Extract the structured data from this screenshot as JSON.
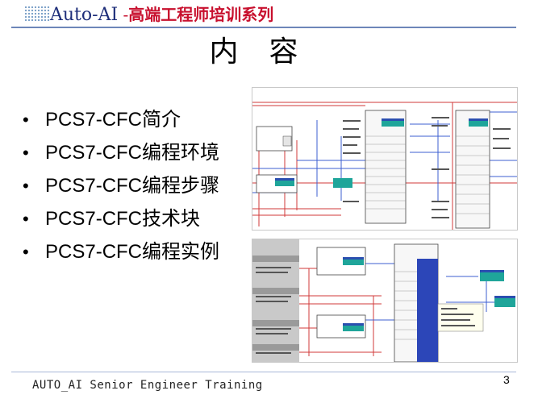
{
  "header": {
    "brand_auto": "Auto-",
    "brand_ai": "AI",
    "brand_dash": " -",
    "brand_subtitle": "高端工程师培训系列"
  },
  "title": "内容",
  "bullets": [
    "PCS7-CFC简介",
    "PCS7-CFC编程环境",
    "PCS7-CFC编程步骤",
    "PCS7-CFC技术块",
    "PCS7-CFC编程实例"
  ],
  "bullet_symbol": "•",
  "images": [
    {
      "name": "cfc-chart-screenshot-1"
    },
    {
      "name": "cfc-chart-screenshot-2"
    }
  ],
  "footer": {
    "text": "AUTO_AI Senior Engineer Training",
    "page_number": "3"
  },
  "colors": {
    "brand_blue": "#1f2f7a",
    "brand_red": "#c8102e",
    "rule_blue": "#6d86b9"
  }
}
